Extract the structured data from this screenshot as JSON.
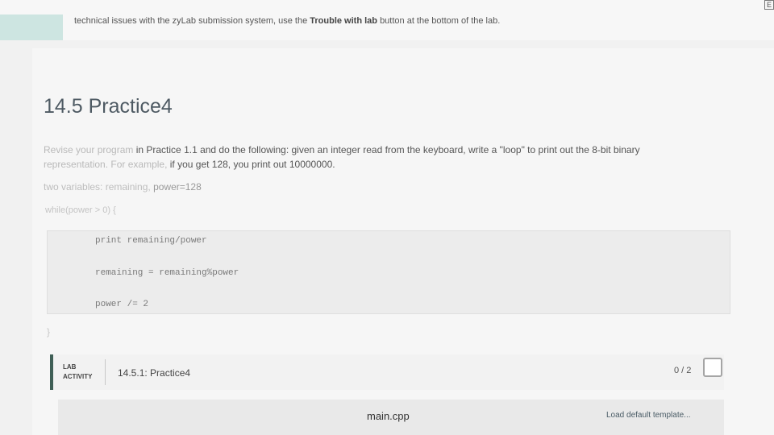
{
  "notice": {
    "prefix": "technical issues with the zyLab submission system, use the",
    "bold": "Trouble with lab",
    "suffix": "button at the bottom of the lab."
  },
  "corner_box_label": "E",
  "section": {
    "title": "14.5 Practice4"
  },
  "description": {
    "line1_faded": "Revise your program",
    "line1": " in Practice 1.1 and do the following: given an integer read from the keyboard, write a \"loop\" to print out the 8-bit binary",
    "line2_faded": "representation. For example,",
    "line2": " if you get 128, you print out 10000000."
  },
  "variables": {
    "faded": "two variables: remaining, ",
    "text": "power=128"
  },
  "loop": {
    "while_line": "while(power > 0) {",
    "code_lines": [
      "print remaining/power",
      "remaining = remaining%power",
      "power /= 2"
    ],
    "close_brace": "}"
  },
  "lab_activity": {
    "label_line1": "LAB",
    "label_line2": "ACTIVITY",
    "title": "14.5.1: Practice4",
    "score": "0 / 2"
  },
  "editor": {
    "filename": "main.cpp",
    "load_template": "Load default template..."
  }
}
